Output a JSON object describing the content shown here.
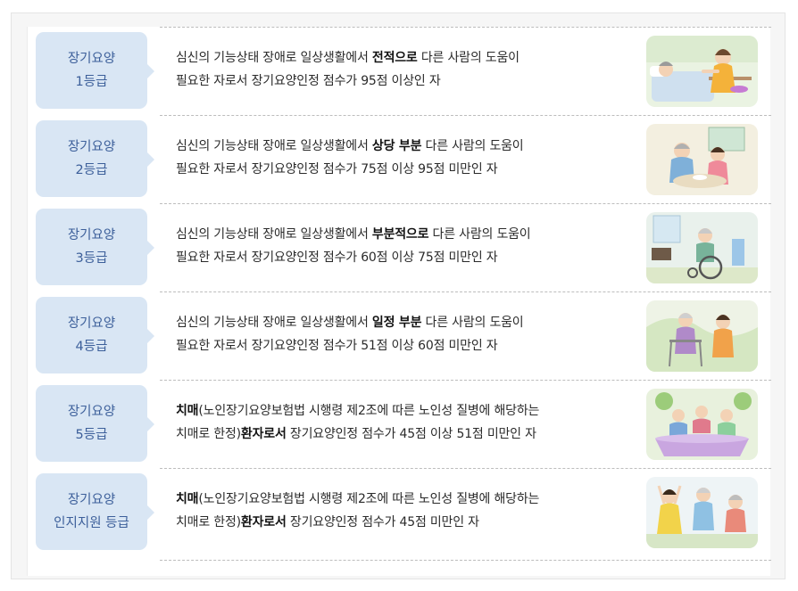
{
  "rows": [
    {
      "grade_line1": "장기요양",
      "grade_line2": "1등급",
      "l1_pre": "심신의 기능상태 장애로 일상생활에서 ",
      "l1_bold": "전적으로",
      "l1_post": " 다른 사람의 도움이",
      "l2_bold_a": "",
      "l2_mid": "",
      "l2_bold_b": "",
      "l2_post": "필요한 자로서 장기요양인정 점수가 95점 이상인 자",
      "illustration": "caregiver-feeding-bedridden-patient"
    },
    {
      "grade_line1": "장기요양",
      "grade_line2": "2등급",
      "l1_pre": "심신의 기능상태 장애로 일상생활에서 ",
      "l1_bold": "상당 부분",
      "l1_post": " 다른 사람의 도움이",
      "l2_bold_a": "",
      "l2_mid": "",
      "l2_bold_b": "",
      "l2_post": "필요한 자로서 장기요양인정 점수가 75점 이상 95점 미만인 자",
      "illustration": "caregiver-serving-meal"
    },
    {
      "grade_line1": "장기요양",
      "grade_line2": "3등급",
      "l1_pre": "심신의 기능상태 장애로 일상생활에서 ",
      "l1_bold": "부분적으로",
      "l1_post": " 다른 사람의 도움이",
      "l2_bold_a": "",
      "l2_mid": "",
      "l2_bold_b": "",
      "l2_post": "필요한 자로서 장기요양인정 점수가 60점 이상 75점 미만인 자",
      "illustration": "elder-in-wheelchair"
    },
    {
      "grade_line1": "장기요양",
      "grade_line2": "4등급",
      "l1_pre": "심신의 기능상태 장애로 일상생활에서 ",
      "l1_bold": "일정 부분",
      "l1_post": " 다른 사람의 도움이",
      "l2_bold_a": "",
      "l2_mid": "",
      "l2_bold_b": "",
      "l2_post": "필요한 자로서 장기요양인정 점수가 51점 이상 60점 미만인 자",
      "illustration": "elder-with-walker"
    },
    {
      "grade_line1": "장기요양",
      "grade_line2": "5등급",
      "l1_pre": "",
      "l1_bold": "치매",
      "l1_post": "(노인장기요양보험법 시행령 제2조에 따른 노인성 질병에 해당하는",
      "l2_bold_a": "",
      "l2_mid": "치매로 한정)",
      "l2_bold_b": "환자로서",
      "l2_post": " 장기요양인정 점수가 45점 이상 51점 미만인 자",
      "illustration": "group-activity-at-table"
    },
    {
      "grade_line1": "장기요양",
      "grade_line2": "인지지원 등급",
      "l1_pre": "",
      "l1_bold": "치매",
      "l1_post": "(노인장기요양보험법 시행령 제2조에 따른 노인성 질병에 해당하는",
      "l2_bold_a": "",
      "l2_mid": "치매로 한정)",
      "l2_bold_b": "환자로서",
      "l2_post": " 장기요양인정 점수가 45점 미만인 자",
      "illustration": "elders-exercising"
    }
  ],
  "colors": {
    "grade_bg": "#d9e6f4",
    "grade_text": "#3c5f9a",
    "body_text": "#2a2a2a"
  }
}
